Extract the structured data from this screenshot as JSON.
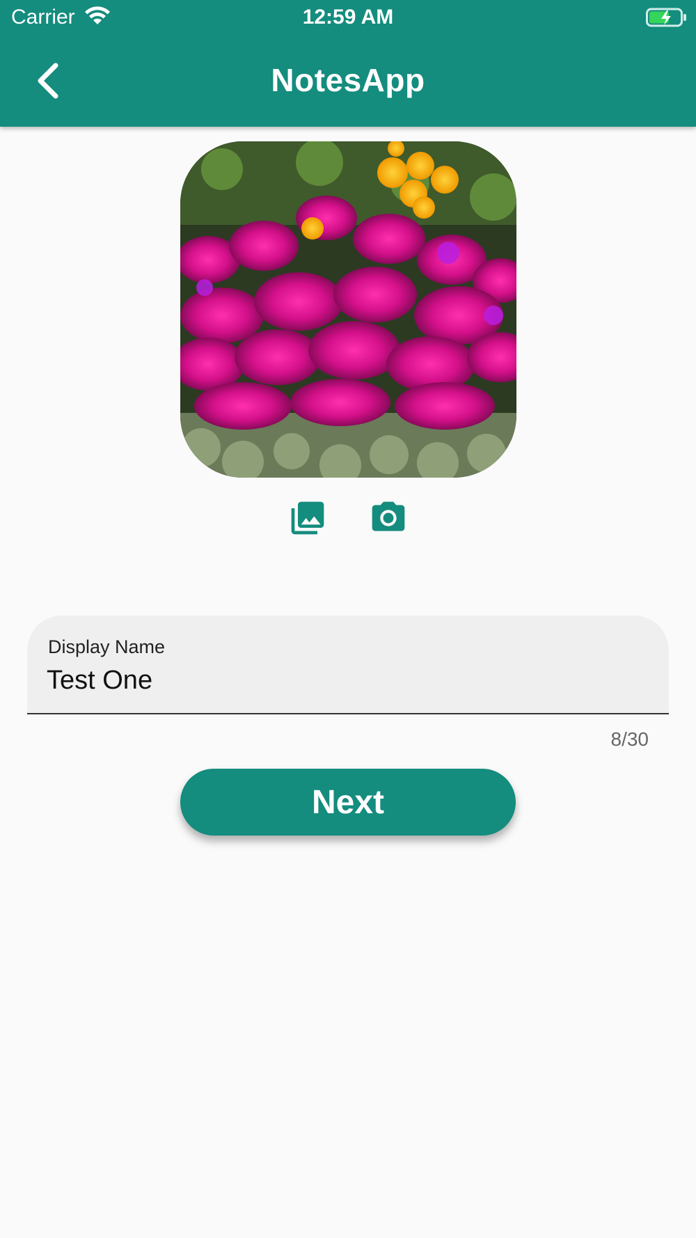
{
  "status_bar": {
    "carrier": "Carrier",
    "time": "12:59 AM"
  },
  "app_bar": {
    "title": "NotesApp",
    "back_icon": "chevron-left-icon"
  },
  "profile_photo": {
    "description": "flower photo"
  },
  "photo_actions": {
    "gallery_icon": "photo-library-icon",
    "camera_icon": "camera-icon"
  },
  "form": {
    "display_name_label": "Display Name",
    "display_name_value": "Test One",
    "counter": "8/30"
  },
  "next_label": "Next",
  "colors": {
    "primary": "#148c7e",
    "background": "#fafafa",
    "field": "#efefef"
  }
}
